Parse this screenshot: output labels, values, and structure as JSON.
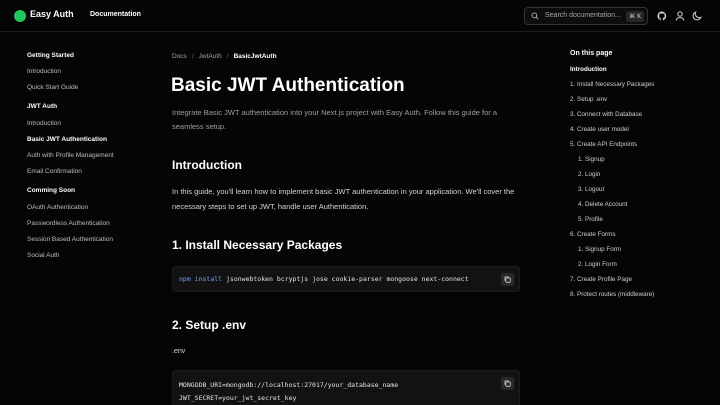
{
  "header": {
    "brand": "Easy Auth",
    "nav_documentation": "Documentation",
    "search_placeholder": "Search documentation...",
    "search_shortcut": "⌘ K",
    "icons": [
      "github-icon",
      "user-icon",
      "moon-icon"
    ],
    "accent_color": "#22c55e"
  },
  "sidebar": {
    "sections": [
      {
        "title": "Getting Started",
        "items": [
          "Introduction",
          "Quick Start Guide"
        ]
      },
      {
        "title": "JWT Auth",
        "items": [
          "Introduction",
          "Basic JWT Authentication",
          "Auth with Profile Management",
          "Email Confirmation"
        ]
      },
      {
        "title": "Comming Soon",
        "items": [
          "OAuth Authentication",
          "Passwordless Authentication",
          "Session Based Authentication",
          "Social Auth"
        ]
      }
    ],
    "active_item": "Basic JWT Authentication"
  },
  "breadcrumb": [
    "Docs",
    "JwtAuth",
    "BasicJwtAuth"
  ],
  "main": {
    "title": "Basic JWT Authentication",
    "lead": "Integrate Basic JWT authentication into your Next.js project with Easy Auth. Follow this guide for a seamless setup.",
    "intro_heading": "Introduction",
    "intro_text": "In this guide, you'll learn how to implement basic JWT authentication in your application. We'll cover the necessary steps to set up JWT, handle user Authentication.",
    "section1_heading": "1. Install Necessary Packages",
    "install_cmd_npm": "npm",
    "install_cmd_install": "install",
    "install_cmd_packages": "jsonwebtoken bcryptjs jose cookie-parser mongoose next-connect",
    "section2_heading": "2. Setup .env",
    "env_label": ".env",
    "env_line1": "MONGODB_URI=mongodb://localhost:27017/your_database_name",
    "env_line2": "JWT_SECRET=your_jwt_secret_key"
  },
  "toc": {
    "title": "On this page",
    "items": [
      {
        "label": "Introduction",
        "level": 0,
        "active": true
      },
      {
        "label": "1. Install Necessary Packages",
        "level": 0
      },
      {
        "label": "2. Setup .env",
        "level": 0
      },
      {
        "label": "3. Connect with Database",
        "level": 0
      },
      {
        "label": "4. Create user model",
        "level": 0
      },
      {
        "label": "5. Create API Endpoints",
        "level": 0
      },
      {
        "label": "1. Signup",
        "level": 1
      },
      {
        "label": "2. Login",
        "level": 1
      },
      {
        "label": "3. Logout",
        "level": 1
      },
      {
        "label": "4. Delete Account",
        "level": 1
      },
      {
        "label": "5. Profile",
        "level": 1
      },
      {
        "label": "6. Create Forms",
        "level": 0
      },
      {
        "label": "1. Signup Form",
        "level": 1
      },
      {
        "label": "2. Login Form",
        "level": 1
      },
      {
        "label": "7. Create Profile Page",
        "level": 0
      },
      {
        "label": "8. Protect routes (middleware)",
        "level": 0
      }
    ]
  }
}
